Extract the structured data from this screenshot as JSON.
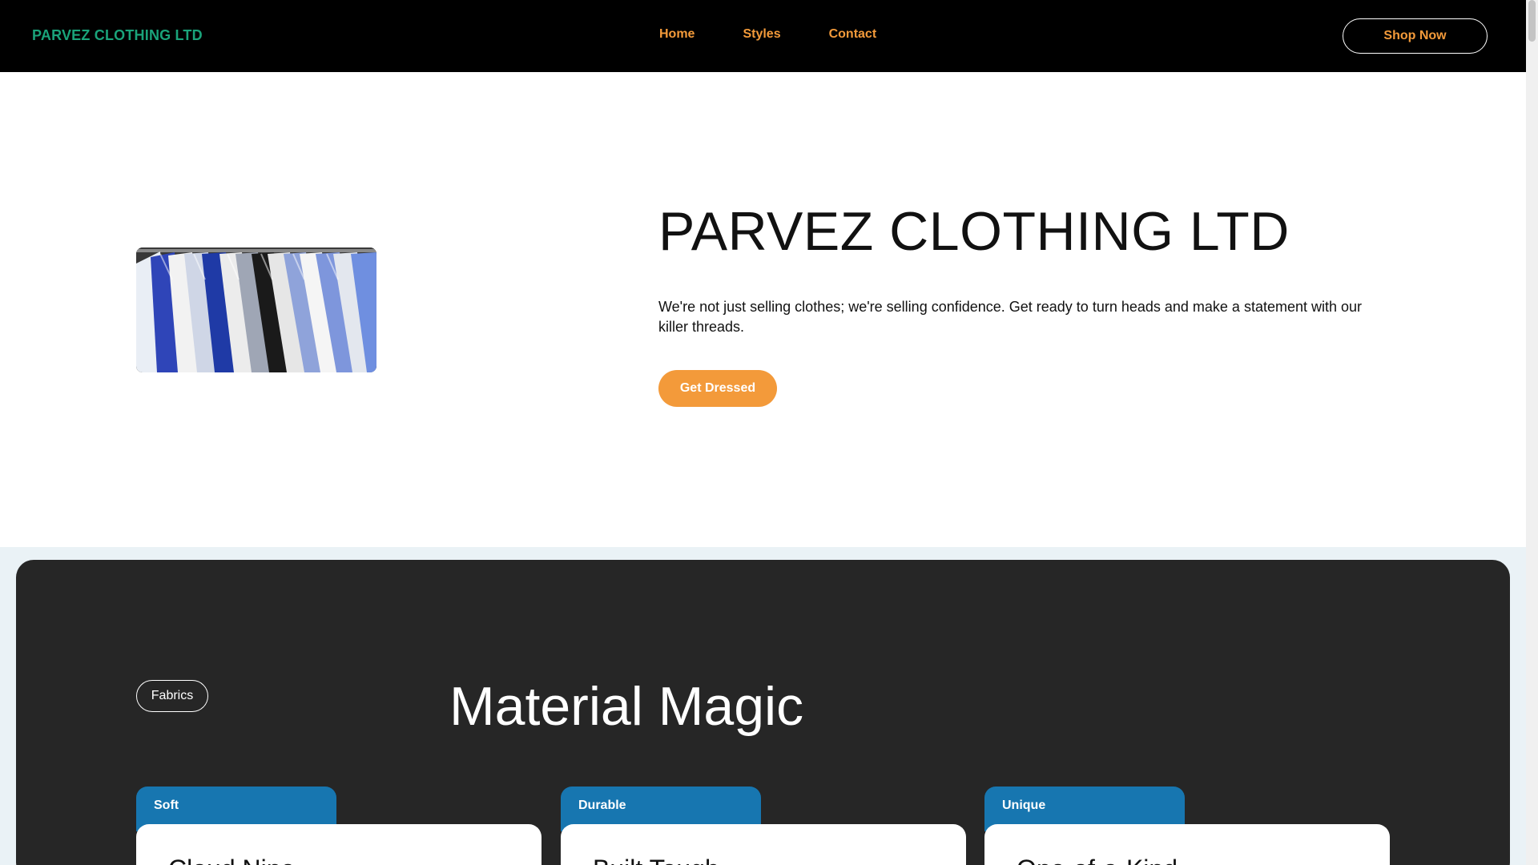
{
  "navbar": {
    "brand": "PARVEZ CLOTHING LTD",
    "links": [
      "Home",
      "Styles",
      "Contact"
    ],
    "cta_label": "Shop Now"
  },
  "hero": {
    "image_alt": "Shirts hanging on a clothing rack",
    "title": "PARVEZ CLOTHING LTD",
    "text": "We're not just selling clothes; we're selling confidence. Get ready to turn heads and make a statement with our killer threads.",
    "button_label": "Get Dressed"
  },
  "materials": {
    "chip_label": "Fabrics",
    "title": "Material Magic",
    "cards": [
      {
        "tab": "Soft",
        "title": "Cloud Nine"
      },
      {
        "tab": "Durable",
        "title": "Built Tough"
      },
      {
        "tab": "Unique",
        "title": "One-of-a-Kind"
      }
    ]
  },
  "colors": {
    "brand_green": "#1aa37a",
    "accent_orange": "#f39a3a",
    "tab_blue": "#1776b0",
    "dark_panel": "#262626"
  }
}
